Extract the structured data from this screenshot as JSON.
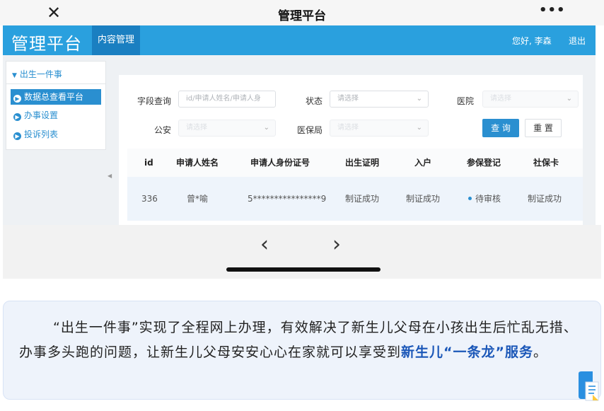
{
  "window": {
    "title": "管理平台",
    "close_glyph": "✕",
    "more_glyph": "•••"
  },
  "header": {
    "brand": "管理平台",
    "active_tab": "内容管理",
    "greeting": "您好, 李森",
    "logout": "退出"
  },
  "sidebar": {
    "group": "出生一件事",
    "items": [
      {
        "label": "数据总查看平台",
        "active": true
      },
      {
        "label": "办事设置",
        "active": false
      },
      {
        "label": "投诉列表",
        "active": false
      }
    ]
  },
  "filters": {
    "field_query_label": "字段查询",
    "field_query_placeholder": "id/申请人姓名/申请人身",
    "status_label": "状态",
    "status_placeholder": "请选择",
    "hospital_label": "医院",
    "hospital_placeholder": "请选择",
    "police_label": "公安",
    "police_placeholder": "请选择",
    "medical_label": "医保局",
    "medical_placeholder": "请选择",
    "query_button": "查 询",
    "reset_button": "重 置"
  },
  "table": {
    "headers": [
      "id",
      "申请人姓名",
      "申请人身份证号",
      "出生证明",
      "入户",
      "参保登记",
      "社保卡"
    ],
    "rows": [
      [
        "336",
        "曾*喻",
        "5****************9",
        "制证成功",
        "制证成功",
        "待审核",
        "制证成功"
      ]
    ]
  },
  "nav": {
    "prev": "‹",
    "next": "›"
  },
  "caption": {
    "text": "“出生一件事”实现了全程网上办理，有效解决了新生儿父母在小孩出生后忙乱无措、办事多头跑的问题，让新生儿父母安安心心在家就可以享受到",
    "highlight": "新生儿“一条龙”服务",
    "end": "。"
  },
  "colors": {
    "header_bg": "#2aa0de",
    "accent": "#2a8fd0",
    "highlight_text": "#1b57b8"
  }
}
